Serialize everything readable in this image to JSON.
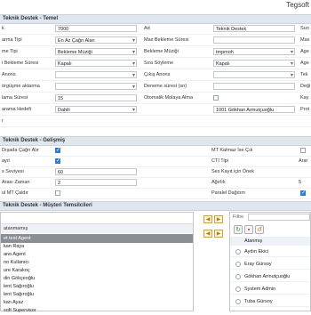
{
  "brand": "Tegsoft",
  "sections": {
    "general": "Teknik Destek - Temel",
    "advanced": "Teknik Destek - Gelişmiş",
    "agents": "Teknik Destek - Müşteri Temsilcileri"
  },
  "general_rows": [
    {
      "l1": "k",
      "v1": "7000",
      "l2": "Ad",
      "v2": "Teknik Destek",
      "l3": "Sun"
    },
    {
      "l1": "arma Tipi",
      "v1": "En Az Çağrı Alan",
      "l2": "Max Bekleme Süresi",
      "v2": "",
      "l3": "Max"
    },
    {
      "l1": "me Tipi",
      "v1": "Bekleme Müziği",
      "l2": "Bekleme Müziği",
      "v2": "tmpmoh",
      "l3": "Age"
    },
    {
      "l1": "i Bekleme Süresi",
      "v1": "Kapalı",
      "l2": "Sıra Söyleme",
      "v2": "Kapalı",
      "l3": "Age"
    },
    {
      "l1": "Anons",
      "v1": "",
      "l2": "Çıkış Anons",
      "v2": "",
      "l3": "Tek"
    },
    {
      "l1": "örgüşme aktarma",
      "v1": "",
      "l2": "Deneme süresi (sn)",
      "v2": "",
      "l3": "Deği"
    },
    {
      "l1": "lama Süresi",
      "v1": "15",
      "l2": "Otomatik Molaya Alma",
      "v2": "",
      "l3": "Kay"
    },
    {
      "l1": "arama Hedefi",
      "v1": "Dahili",
      "l2": "",
      "v2": "1001 Gökhan Armutçuoğlu",
      "l3": "Prot"
    },
    {
      "l1": "r",
      "v1": "",
      "l2": "",
      "v2": "",
      "l3": ""
    }
  ],
  "advanced_rows": [
    {
      "l1": "Dışada Çağrı Alır",
      "c1": true,
      "l2": "MT Kalmaz İse Çık",
      "c2": false,
      "r": ""
    },
    {
      "l1": "ayıt",
      "c1": true,
      "l2": "CTI Tipi",
      "c2": null,
      "r": "Arar"
    },
    {
      "l1": "s Seviyesi",
      "v1": "60",
      "l2": "Ses Kayıt için Önek",
      "c2": null,
      "r": ""
    },
    {
      "l1": " Arası Zaman",
      "v1": "2",
      "l2": "Ağırlık",
      "c2": null,
      "r": "5"
    },
    {
      "l1": "ul MT Çaldır",
      "c1": false,
      "l2": "Paralel Dağıtım",
      "c2": true,
      "r": ""
    }
  ],
  "left_panel": {
    "header": "atanmamış",
    "items": [
      "et test Agent",
      "kan Raya",
      "ano Agent",
      "no Kullanıcı",
      "ure Karakoç",
      "din Gökçeoğlu",
      "lent Sağıroğlu",
      "lent Sağıroğlu",
      "kan Ayaz",
      "soft Supervisor"
    ]
  },
  "right_panel": {
    "filter_label": "Filtre",
    "header": "Atanmış",
    "items": [
      "Aydın Ekici",
      "Eray Gürsoy",
      "Gökhan Armutçuoğlu",
      "System Admin",
      "Tuba Gürsoy"
    ]
  },
  "icons": [
    "arrow-left-icon",
    "arrow-right-icon",
    "refresh-icon",
    "save-icon",
    "reset-icon"
  ]
}
